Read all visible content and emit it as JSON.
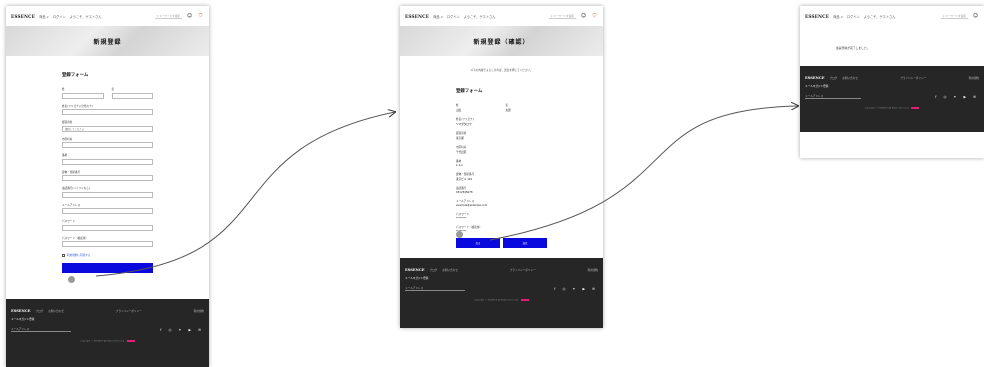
{
  "header": {
    "logo": "ESSENCE",
    "nav": [
      "商品 ∨",
      "ログイン",
      "ようこそ、ゲストさん"
    ],
    "search_placeholder": "キーワードを検索"
  },
  "page1": {
    "hero_title": "新規登録",
    "form_title": "登録フォーム",
    "fields": {
      "sei": "姓",
      "mei": "名",
      "furigana": "姓名(フリガナ) (全角カナ)",
      "prefecture": "都道府県",
      "prefecture_value": "選択してください",
      "zip": "市区町村",
      "address": "番地",
      "building": "建物・部屋番号",
      "phone": "電話番号(ハイフンなし)",
      "email": "メールアドレス",
      "password": "パスワード",
      "password_confirm": "パスワード（確認用）"
    },
    "agree_label": "利用規約に同意する"
  },
  "page2": {
    "hero_title": "新規登録（確認）",
    "note": "以下の内容でよろしければ、送信を押してください。",
    "form_title": "登録フォーム",
    "rows": [
      {
        "label": "姓",
        "value": "山田"
      },
      {
        "label": "名",
        "value": "太郎"
      },
      {
        "label": "姓名(フリガナ)",
        "value": "ヤマダタロウ"
      },
      {
        "label": "都道府県",
        "value": "東京都"
      },
      {
        "label": "市区町村",
        "value": "千代田区"
      },
      {
        "label": "番地",
        "value": "1-1-1"
      },
      {
        "label": "建物・部屋番号",
        "value": "東京ビル 101"
      },
      {
        "label": "電話番号",
        "value": "0312345678"
      },
      {
        "label": "メールアドレス",
        "value": "example@example.com"
      },
      {
        "label": "パスワード",
        "value": "********"
      },
      {
        "label": "パスワード（確認用）",
        "value": "********"
      }
    ],
    "back_button": "戻る",
    "submit_button": "送信"
  },
  "page3": {
    "message": "会員登録が完了しました。"
  },
  "footer": {
    "logo": "ESSENCE",
    "links": [
      "ブログ",
      "お問い合わせ"
    ],
    "mid_link": "プライバシーポリシー",
    "right_link": "利用規約",
    "newsletter": "メールマガジン登録",
    "email_placeholder": "メールアドレス",
    "social": "f ◎ ✦ ▶ ✉",
    "copyright": "Copyright © ESSENCE All Rights Reserved."
  }
}
